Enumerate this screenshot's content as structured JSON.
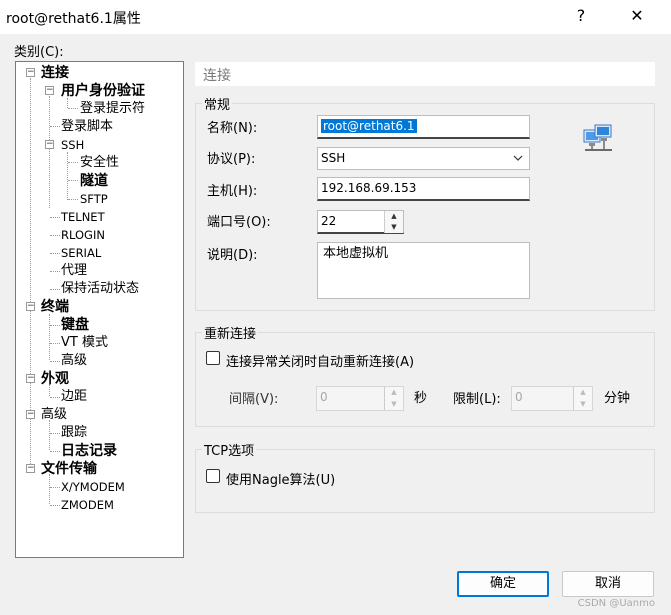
{
  "window": {
    "title": "root@rethat6.1属性",
    "help_glyph": "?",
    "close_glyph": "✕"
  },
  "category_label": "类别(C):",
  "tree": {
    "connection": "连接",
    "user_auth": "用户身份验证",
    "login_prompt": "登录提示符",
    "login_script": "登录脚本",
    "ssh": "SSH",
    "security": "安全性",
    "tunnel": "隧道",
    "sftp": "SFTP",
    "telnet": "TELNET",
    "rlogin": "RLOGIN",
    "serial": "SERIAL",
    "proxy": "代理",
    "keepalive": "保持活动状态",
    "terminal": "终端",
    "keyboard": "键盘",
    "vt_mode": "VT 模式",
    "advanced_term": "高级",
    "appearance": "外观",
    "margin": "边距",
    "advanced": "高级",
    "trace": "跟踪",
    "logging": "日志记录",
    "file_transfer": "文件传输",
    "xymodem": "X/YMODEM",
    "zmodem": "ZMODEM"
  },
  "panel": {
    "header": "连接"
  },
  "general": {
    "group_label": "常规",
    "name_label": "名称(N):",
    "name_value": "root@rethat6.1",
    "protocol_label": "协议(P):",
    "protocol_value": "SSH",
    "host_label": "主机(H):",
    "host_value": "192.168.69.153",
    "port_label": "端口号(O):",
    "port_value": "22",
    "desc_label": "说明(D):",
    "desc_value": "本地虚拟机"
  },
  "reconnect": {
    "group_label": "重新连接",
    "checkbox_label": "连接异常关闭时自动重新连接(A)",
    "interval_label": "间隔(V):",
    "interval_value": "0",
    "seconds_unit": "秒",
    "limit_label": "限制(L):",
    "limit_value": "0",
    "minutes_unit": "分钟"
  },
  "tcp": {
    "group_label": "TCP选项",
    "nagle_label": "使用Nagle算法(U)"
  },
  "buttons": {
    "ok": "确定",
    "cancel": "取消"
  },
  "watermark": "CSDN @Uanmo",
  "colors": {
    "accent": "#0078d7",
    "background": "#f0f0f0"
  }
}
